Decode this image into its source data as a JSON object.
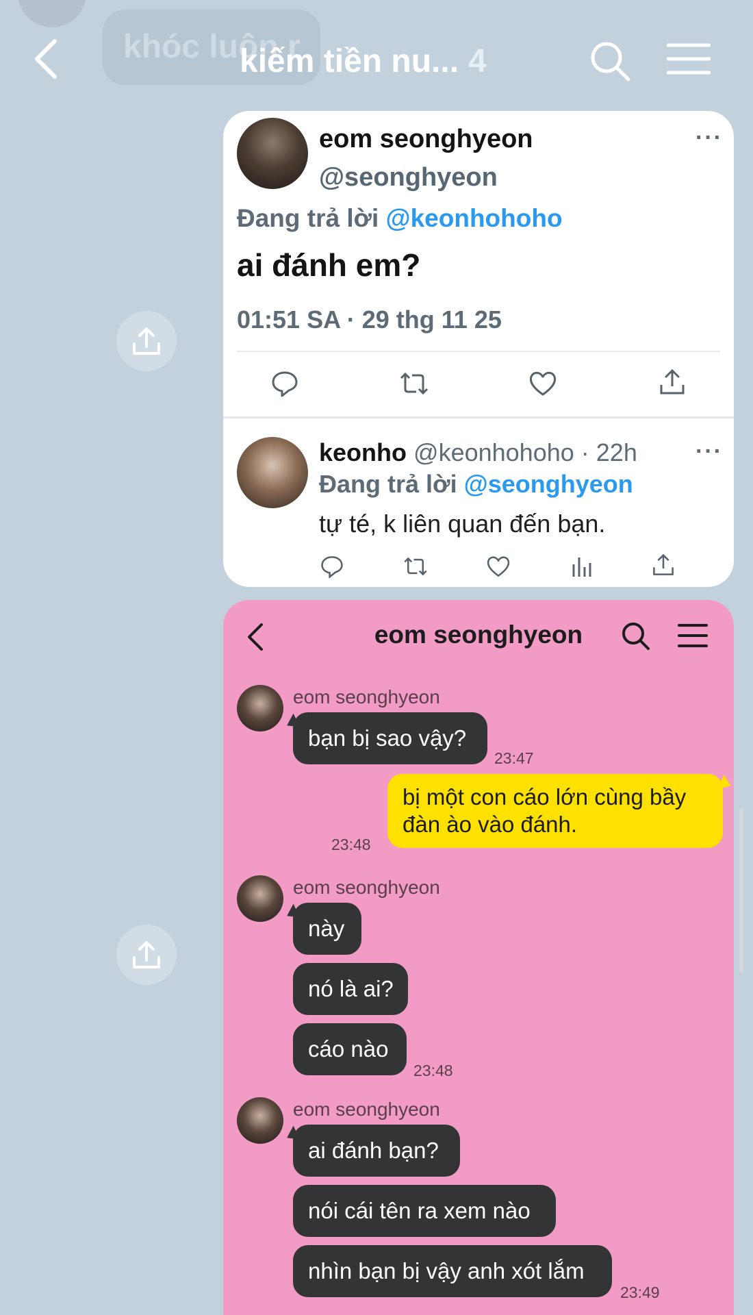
{
  "header": {
    "title": "kiếm tiền nu...",
    "member_count": "4",
    "ghost_message": "khóc luôn r"
  },
  "tweet": {
    "author_name": "eom seonghyeon",
    "author_handle": "@seonghyeon",
    "reply_prefix": "Đang trả lời",
    "reply_to": "@keonhohoho",
    "text": "ai đánh em?",
    "timestamp": "01:51 SA · 29 thg 11 25",
    "more": "···"
  },
  "reply": {
    "author_name": "keonho",
    "author_handle": "@keonhohoho",
    "age": "· 22h",
    "reply_prefix": "Đang trả lời",
    "reply_to": "@seonghyeon",
    "text": "tự té, k liên quan đến bạn.",
    "more": "···"
  },
  "chat": {
    "title": "eom seonghyeon",
    "groups": [
      {
        "sender": "eom seonghyeon",
        "messages": [
          "bạn bị sao vậy?"
        ],
        "time": "23:47"
      },
      {
        "own": true,
        "text": "bị một con cáo lớn cùng bầy đàn ào vào đánh.",
        "time": "23:48"
      },
      {
        "sender": "eom seonghyeon",
        "messages": [
          "này",
          "nó là ai?",
          "cáo nào"
        ],
        "time": "23:48"
      },
      {
        "sender": "eom seonghyeon",
        "messages": [
          "ai đánh bạn?",
          "nói cái tên ra xem nào",
          "nhìn bạn bị vậy anh xót lắm"
        ],
        "time": "23:49"
      }
    ]
  },
  "colors": {
    "background": "#c3d1dd",
    "chat_background": "#f29cc5",
    "own_bubble": "#ffe100",
    "other_bubble": "#333435",
    "mention_blue": "#2a9af0"
  },
  "icons": [
    "back-icon",
    "search-icon",
    "menu-icon",
    "share-icon",
    "reply-icon",
    "retweet-icon",
    "like-icon",
    "analytics-icon"
  ]
}
